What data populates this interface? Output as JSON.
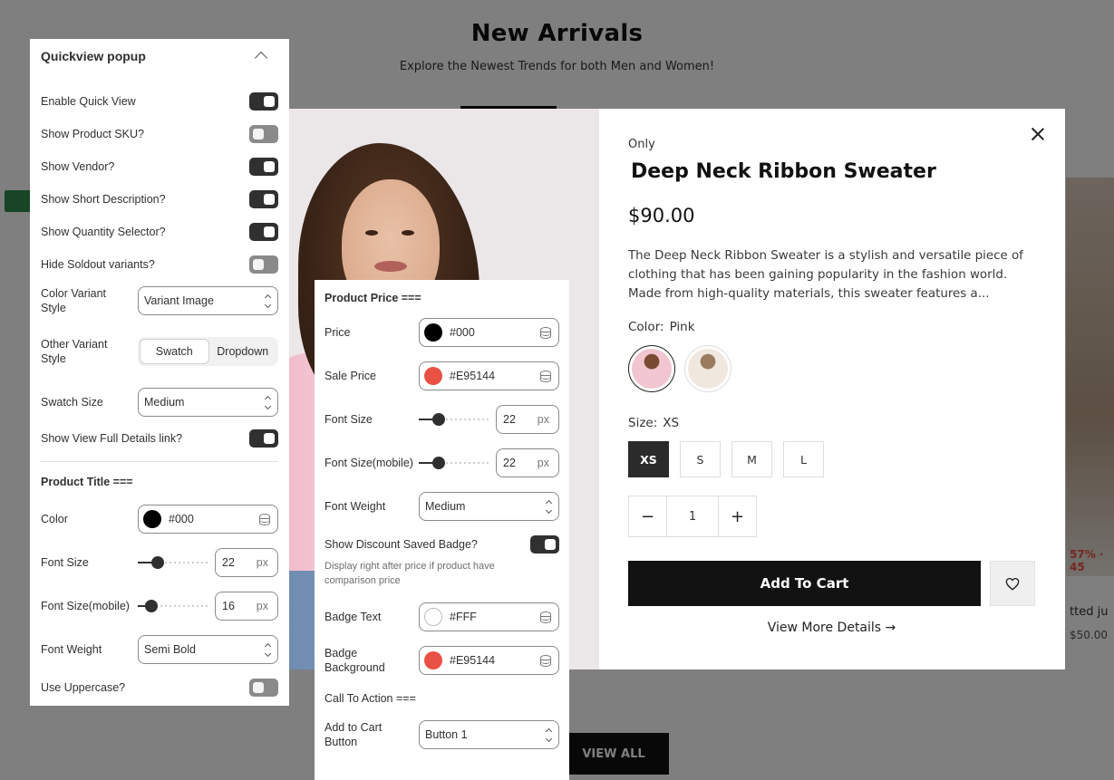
{
  "background": {
    "section_title": "New Arrivals",
    "section_subtitle": "Explore the Newest Trends for both Men and Women!",
    "right_card_price_red": "57% · 45",
    "right_card_title": "tted ju",
    "right_card_price": "$50.00",
    "view_all_label": "VIEW ALL"
  },
  "quickview": {
    "vendor": "Only",
    "title": "Deep Neck Ribbon Sweater",
    "price": "$90.00",
    "description": "The Deep Neck Ribbon Sweater is a stylish and versatile piece of clothing that has been gaining popularity in the fashion world. Made from high-quality materials, this sweater features a...",
    "color_label": "Color:",
    "color_value": "Pink",
    "size_label": "Size:",
    "size_value": "XS",
    "sizes": [
      "XS",
      "S",
      "M",
      "L"
    ],
    "selected_size": "XS",
    "quantity": "1",
    "qty_minus": "−",
    "qty_plus": "+",
    "add_to_cart": "Add To Cart",
    "view_more": "View More Details →",
    "close_icon": "close-icon",
    "wishlist_icon": "heart-icon"
  },
  "left_panel": {
    "title": "Quickview popup",
    "toggles": [
      {
        "label": "Enable Quick View",
        "on": true
      },
      {
        "label": "Show Product SKU?",
        "on": false
      },
      {
        "label": "Show Vendor?",
        "on": true
      },
      {
        "label": "Show Short Description?",
        "on": true
      },
      {
        "label": "Show Quantity Selector?",
        "on": true
      },
      {
        "label": "Hide Soldout variants?",
        "on": false
      }
    ],
    "color_variant_style_label": "Color Variant Style",
    "color_variant_style_value": "Variant Image",
    "other_variant_style_label": "Other Variant Style",
    "other_variant_options": [
      "Swatch",
      "Dropdown"
    ],
    "other_variant_selected": "Swatch",
    "swatch_size_label": "Swatch Size",
    "swatch_size_value": "Medium",
    "show_full_details_label": "Show View Full Details link?",
    "show_full_details_on": true,
    "product_title_section": "Product Title ===",
    "color_label": "Color",
    "color_value": "#000",
    "color_hex": "#000000",
    "font_size_label": "Font Size",
    "font_size_value": "22",
    "font_size_mobile_label": "Font Size(mobile)",
    "font_size_mobile_value": "16",
    "unit": "px",
    "font_weight_label": "Font Weight",
    "font_weight_value": "Semi Bold",
    "uppercase_label": "Use Uppercase?",
    "uppercase_on": false
  },
  "mid_panel": {
    "section_title": "Product Price ===",
    "price_label": "Price",
    "price_color": "#000",
    "price_hex": "#000000",
    "sale_price_label": "Sale Price",
    "sale_price_color": "#E95144",
    "sale_price_hex": "#E95144",
    "font_size_label": "Font Size",
    "font_size_value": "22",
    "font_size_mobile_label": "Font Size(mobile)",
    "font_size_mobile_value": "22",
    "unit": "px",
    "font_weight_label": "Font Weight",
    "font_weight_value": "Medium",
    "discount_badge_label": "Show Discount Saved Badge?",
    "discount_badge_on": true,
    "discount_badge_help": "Display right after price if product have comparison price",
    "badge_text_label": "Badge Text",
    "badge_text_color": "#FFF",
    "badge_text_hex": "#FFFFFF",
    "badge_bg_label": "Badge Background",
    "badge_bg_color": "#E95144",
    "badge_bg_hex": "#E95144",
    "cta_section": "Call To Action ===",
    "add_to_cart_button_label": "Add to Cart Button",
    "add_to_cart_button_value": "Button 1"
  }
}
